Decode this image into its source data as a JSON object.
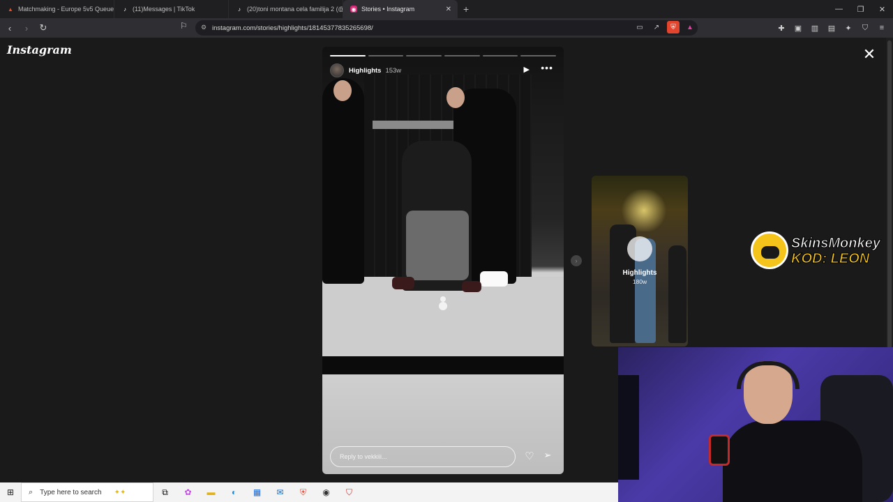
{
  "browser": {
    "tabs": [
      {
        "title": "Matchmaking - Europe 5v5 Queue -",
        "favicon": "faceit-icon",
        "color": "#e8501e"
      },
      {
        "title": "(11)Messages | TikTok",
        "favicon": "tiktok-icon",
        "color": "#ffffff"
      },
      {
        "title": "(20)toni montana cela familija 2 (@to",
        "favicon": "tiktok-icon",
        "color": "#ffffff"
      },
      {
        "title": "Stories • Instagram",
        "favicon": "instagram-icon",
        "color": "#d62976"
      }
    ],
    "url": "instagram.com/stories/highlights/18145377835265698/"
  },
  "page": {
    "logo": "Instagram",
    "story": {
      "username": "Highlights",
      "time": "153w",
      "progress_total": 6,
      "progress_done": 1,
      "reply_placeholder": "Reply to vekkiii..."
    },
    "next_story": {
      "name": "Highlights",
      "time": "180w"
    }
  },
  "overlay": {
    "sponsor_line1": "SkinsMonkey",
    "sponsor_line2": "KOD: LEON"
  },
  "taskbar": {
    "search_placeholder": "Type here to search"
  }
}
